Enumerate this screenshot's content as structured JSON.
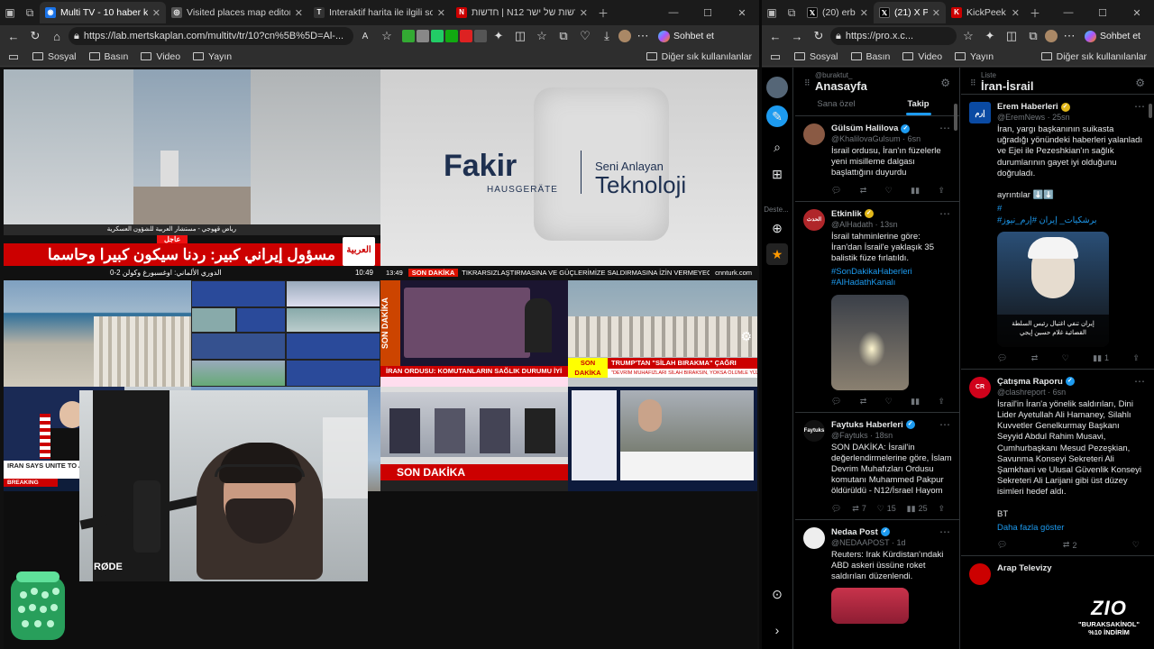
{
  "left_window": {
    "tabs": [
      {
        "label": "",
        "icon": "workspaces-icon"
      },
      {
        "label": "Multi TV - 10 haber kanalını a",
        "active": true,
        "fav_color": "#1a73e8"
      },
      {
        "label": "Visited places map editor",
        "fav_color": "#555"
      },
      {
        "label": "Interaktif harita ile ilgili son İran h",
        "fav_color": "#333"
      },
      {
        "label": "חדשות | N12 אתר החדשות של ישר",
        "fav_color": "#c00"
      }
    ],
    "url": "https://lab.mertskaplan.com/multitv/tr/10?cn%5B%5D=Al-...",
    "chat_label": "Sohbet et",
    "bookmarks": [
      "Sosyal",
      "Basın",
      "Video",
      "Yayın"
    ],
    "bookmarks_other": "Diğer sık kullanılanlar"
  },
  "right_window": {
    "tabs": [
      {
        "label": "(20) erbil ai",
        "fav_color": "#000"
      },
      {
        "label": "(21) X Pro",
        "active": true,
        "fav_color": "#000"
      },
      {
        "label": "KickPeek - I",
        "fav_color": "#c00"
      }
    ],
    "url": "https://pro.x.c...",
    "chat_label": "Sohbet et",
    "bookmarks": [
      "Sosyal",
      "Basın",
      "Video",
      "Yayın"
    ],
    "bookmarks_other": "Diğer sık kullanılanlar"
  },
  "tv": {
    "arabiya_headline": "مسؤول إيراني كبير: ردنا سيكون كبيرا وحاسما",
    "arabiya_breaking": "عاجل",
    "arabiya_ticker": "الدوري الألماني: اوغسبورغ وكولن 2-0",
    "arabiya_time": "10:49",
    "arabiya_caption": "رياض قهوجي - مستشار العربية للشؤون العسكرية",
    "fakir_brand": "Fakir",
    "fakir_sub": "HAUSGERÄTE",
    "fakir_slogan_1": "Seni Anlayan",
    "fakir_slogan_2": "Teknoloji",
    "cnn_time": "13:49",
    "cnn_tag": "SON DAKİKA",
    "cnn_ticker": "TIKRARSIZLAŞTIRMASINA VE GÜÇLERİMİZE SALDIRMASINA İZİN VERMEYECEĞİZ",
    "cnn_site": "cnnturk.com",
    "tile_headline_1": "İRAN ORDUSU: KOMUTANLARIN SAĞLIK DURUMU İYİ",
    "tile_tag_1": "SON DAKİKA",
    "tile_headline_2": "TRUMP'TAN \"SİLAH BIRAKMA\" ÇAĞRI",
    "tile_sub_2": "\"DEVRİM MUHAFIZLARI SİLAH BIRAKSIN, YOKSA ÖLÜMLE YÜZLEŞİR\"",
    "tile_tag_2": "SON DAKİKA",
    "tile_headline_3": "SON DAKİKA",
    "aj_headline": "IRAN SAYS UNITE TO A MISSILE ATTACK",
    "aj_breaking": "BREAKING",
    "mic_brand": "RØDE"
  },
  "columns": [
    {
      "sub": "@buraktut_",
      "title": "Anasayfa",
      "tabs": [
        "Sana özel",
        "Takip"
      ],
      "tweets": [
        {
          "name": "Gülsüm Halilova",
          "verified": "blue",
          "handle": "@KhalilovaGulsum · 6sn",
          "text": "İsrail ordusu, İran'ın füzelerle yeni misilleme dalgası başlattığını duyurdu",
          "avatar_color": "#8a5a44",
          "actions": [
            "",
            "",
            "",
            "",
            ""
          ]
        },
        {
          "name": "Etkinlik",
          "verified": "gold",
          "handle": "@AlHadath · 13sn",
          "text": "İsrail tahminlerine göre: İran'dan İsrail'e yaklaşık 35 balistik füze fırlatıldı.",
          "tags": "#SonDakikaHaberleri\n#AlHadathKanalı",
          "avatar_color": "#b0262a",
          "avatar_text": "الحدث",
          "media": true,
          "actions": [
            "",
            "",
            "",
            "",
            ""
          ]
        },
        {
          "name": "Faytuks Haberleri",
          "verified": "blue",
          "handle": "@Faytuks · 18sn",
          "text": "SON DAKİKA: İsrail'in değerlendirmelerine göre, İslam Devrim Muhafızları Ordusu komutanı Muhammed Pakpur öldürüldü - N12/İsrael Hayom",
          "avatar_color": "#111",
          "avatar_text": "Faytuks",
          "actions": [
            "",
            "7",
            "15",
            "25",
            ""
          ]
        },
        {
          "name": "Nedaa Post",
          "verified": "blue",
          "handle": "@NEDAAPOST · 1d",
          "text": "Reuters: Irak Kürdistan'ındaki ABD askeri üssüne roket saldırıları düzenlendi.",
          "avatar_color": "#eee",
          "actions": [
            "",
            "",
            "",
            "",
            ""
          ]
        }
      ]
    },
    {
      "sub": "Liste",
      "title": "İran-İsrail",
      "tweets": [
        {
          "name": "Erem Haberleri",
          "verified": "gold",
          "handle": "@EremNews · 25sn",
          "text": "İran, yargı başkanının suikasta uğradığı yönündeki haberleri yalanladı ve Ejei ile Pezeshkian'ın sağlık durumlarının gayet iyi olduğunu doğruladı.\n\nayrıntılar ⬇️⬇️",
          "tags": "#\n#برشكيات_ إيران #إرم_نيوز",
          "avatar_color": "#0a4aa3",
          "avatar_text": "إرم",
          "media": true,
          "media_caption": "إيران تنفي اغتيال رئيس السلطة\nالقضائية غلام حسين إيجي",
          "actions": [
            "",
            "",
            "",
            "1",
            ""
          ]
        },
        {
          "name": "Çatışma Raporu",
          "verified": "blue",
          "handle": "@clashreport · 6sn",
          "text": "İsrail'in İran'a yönelik saldırıları, Dini Lider Ayetullah Ali Hamaney, Silahlı Kuvvetler Genelkurmay Başkanı Seyyid Abdul Rahim Musavi, Cumhurbaşkanı Mesud Pezeşkian, Savunma Konseyi Sekreteri Ali Şamkhani ve Ulusal Güvenlik Konseyi Sekreteri Ali Larijani gibi üst düzey isimleri hedef aldı.\n\nBT",
          "more": "Daha fazla göster",
          "avatar_color": "#d0021b",
          "avatar_text": "CR",
          "actions": [
            "",
            "2",
            "",
            "",
            ""
          ]
        },
        {
          "name": "Arap Televizy",
          "verified": "",
          "handle": "",
          "text": "",
          "avatar_color": "#c00"
        }
      ]
    }
  ],
  "overlay": {
    "logo": "ZIO",
    "handle": "\"BURAKSAKİNOL\"",
    "promo": "%10 İNDİRİM"
  }
}
